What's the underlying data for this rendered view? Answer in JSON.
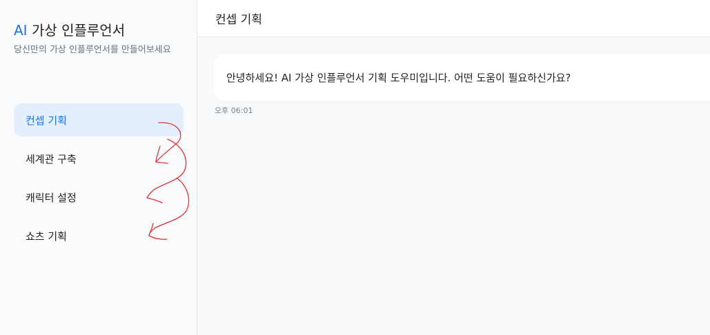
{
  "brand": {
    "ai": "AI",
    "title": " 가상 인플루언서",
    "subtitle": "당신만의 가상 인플루언서를 만들어보세요"
  },
  "nav": {
    "items": [
      {
        "label": "컨셉 기획",
        "active": true
      },
      {
        "label": "세계관 구축",
        "active": false
      },
      {
        "label": "캐릭터 설정",
        "active": false
      },
      {
        "label": "쇼츠 기획",
        "active": false
      }
    ]
  },
  "header": {
    "title": "컨셉 기획"
  },
  "chat": {
    "message": "안녕하세요! AI 가상 인플루언서 기획 도우미입니다. 어떤 도움이 필요하신가요?",
    "time": "오후 06:01"
  },
  "colors": {
    "accent": "#1a73e8",
    "active_bg": "#e3effc",
    "annotation": "#e03030"
  }
}
